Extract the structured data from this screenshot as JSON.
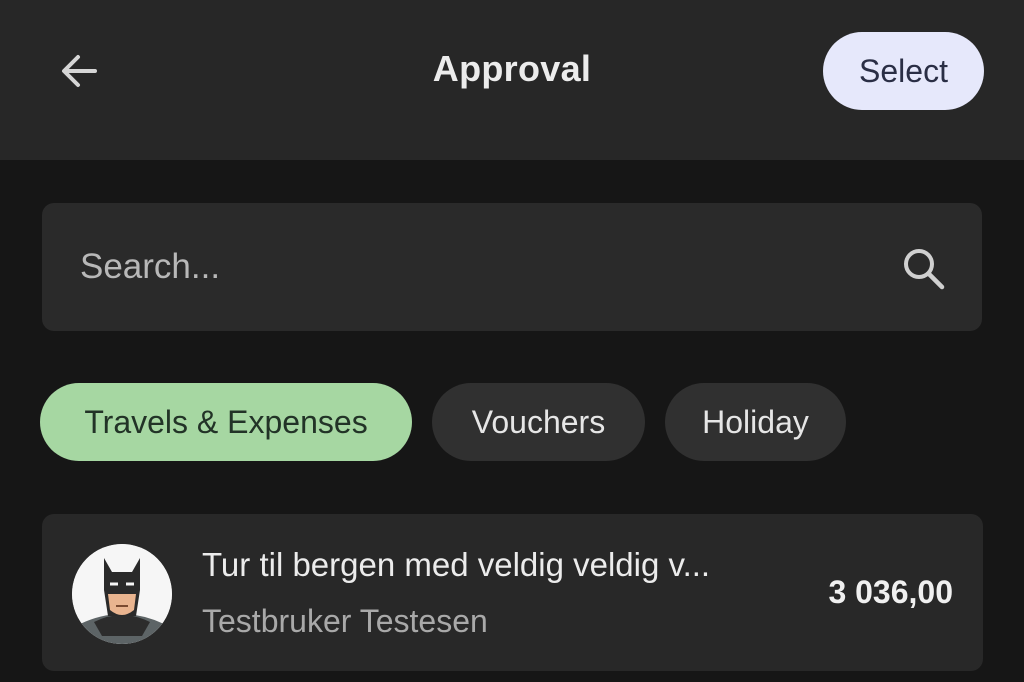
{
  "header": {
    "title": "Approval",
    "back_icon": "arrow-left-icon",
    "select_label": "Select"
  },
  "search": {
    "value": "",
    "placeholder": "Search...",
    "icon": "search-icon"
  },
  "filters": {
    "chips": [
      {
        "label": "Travels & Expenses",
        "active": true
      },
      {
        "label": "Vouchers",
        "active": false
      },
      {
        "label": "Holiday",
        "active": false
      }
    ]
  },
  "items": [
    {
      "title": "Tur til bergen med veldig veldig v...",
      "subtitle": "Testbruker Testesen",
      "amount": "3 036,00",
      "avatar": "batman-avatar"
    }
  ],
  "colors": {
    "background": "#161616",
    "header": "#272727",
    "surface": "#2a2a2a",
    "select_button": "#e6e8fb",
    "chip_active": "#a6d7a2",
    "chip_inactive": "#303030"
  }
}
